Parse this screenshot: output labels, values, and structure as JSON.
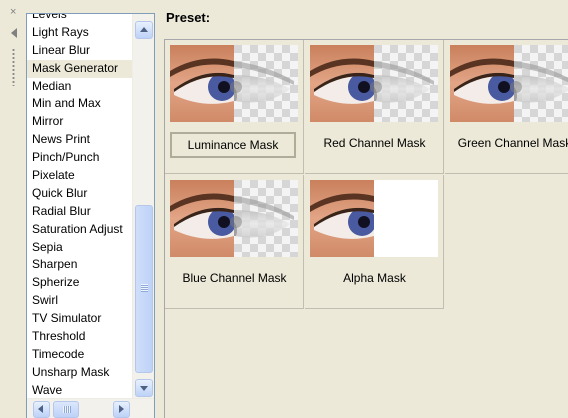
{
  "left_toolbar": {
    "close_glyph": "×"
  },
  "filters": {
    "items": [
      "Levels",
      "Light Rays",
      "Linear Blur",
      "Mask Generator",
      "Median",
      "Min and Max",
      "Mirror",
      "News Print",
      "Pinch/Punch",
      "Pixelate",
      "Quick Blur",
      "Radial Blur",
      "Saturation Adjust",
      "Sepia",
      "Sharpen",
      "Spherize",
      "Swirl",
      "TV Simulator",
      "Threshold",
      "Timecode",
      "Unsharp Mask",
      "Wave"
    ],
    "selected": "Mask Generator"
  },
  "panel": {
    "title": "Preset:"
  },
  "presets": [
    {
      "label": "Luminance Mask",
      "mask": "luminance",
      "selected": true
    },
    {
      "label": "Red Channel Mask",
      "mask": "red",
      "selected": false
    },
    {
      "label": "Green Channel Mask",
      "mask": "green",
      "selected": false
    },
    {
      "label": "Blue Channel Mask",
      "mask": "blue",
      "selected": false
    },
    {
      "label": "Alpha Mask",
      "mask": "alpha",
      "selected": false
    }
  ]
}
